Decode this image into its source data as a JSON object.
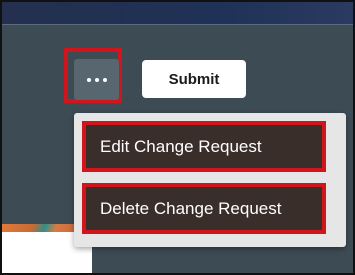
{
  "toolbar": {
    "more_icon": "more-horizontal-icon",
    "submit_label": "Submit"
  },
  "menu": {
    "items": [
      {
        "label": "Edit Change Request"
      },
      {
        "label": "Delete Change Request"
      }
    ]
  },
  "colors": {
    "highlight": "#d0151c",
    "header": "#24304e",
    "panel": "#3d4b55",
    "menu_bg": "#e6e6e6",
    "menu_item_bg": "#3a2e2a"
  }
}
